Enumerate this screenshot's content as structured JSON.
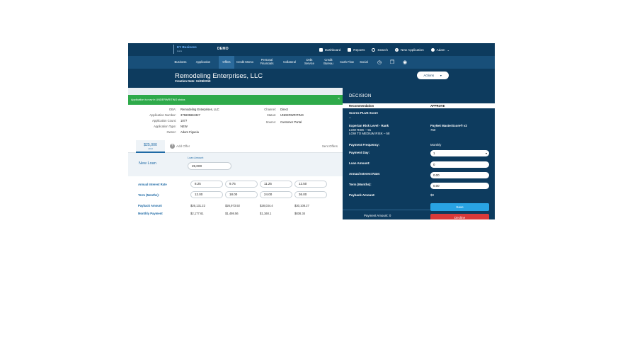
{
  "topbar": {
    "logo_name": "EY Business",
    "logo_sub": "loans",
    "environment": "DEMO",
    "nav": [
      {
        "label": "Dashboard",
        "icon": "dashboard-icon"
      },
      {
        "label": "Reports",
        "icon": "reports-icon"
      },
      {
        "label": "Search",
        "icon": "search-icon"
      },
      {
        "label": "New Application",
        "icon": "plus-circle-icon"
      },
      {
        "label": "Adam",
        "icon": "user-icon"
      }
    ],
    "user_caret": "⌄"
  },
  "tabs": [
    {
      "label": "Business"
    },
    {
      "label": "Application"
    },
    {
      "label": "Offers",
      "active": true
    },
    {
      "label": "Credit Memo"
    },
    {
      "label": "Personal Financials"
    },
    {
      "label": "Collateral"
    },
    {
      "label": "Debt Service"
    },
    {
      "label": "Credit Bureau"
    },
    {
      "label": "Cash Flow"
    },
    {
      "label": "Social"
    }
  ],
  "tab_icons": [
    "history-icon",
    "documents-icon",
    "eye-icon"
  ],
  "header": {
    "company": "Remodeling Enterprises, LLC",
    "created": "Creation Date: 11/26/2019",
    "actions_label": "Actions"
  },
  "banner": {
    "text": "Application is now in UNDERWRITING status",
    "close": "×"
  },
  "details_left": [
    {
      "label": "DBA:",
      "value": "Remodeling Enterprises, LLC"
    },
    {
      "label": "Application Number:",
      "value": "375605684327"
    },
    {
      "label": "Application Count:",
      "value": "1077"
    },
    {
      "label": "Application Type:",
      "value": "NEW"
    },
    {
      "label": "Owner:",
      "value": "Adam Figueia"
    }
  ],
  "details_right": [
    {
      "label": "Channel:",
      "value": "Direct"
    },
    {
      "label": "Status:",
      "value": "UNDERWRITING"
    },
    {
      "label": "Source:",
      "value": "Customer Portal"
    }
  ],
  "offers": {
    "active_amount": "$25,000",
    "active_sub": "ACH",
    "add_label": "Add Offer",
    "sent_label": "Sent Offers"
  },
  "new_loan": {
    "title": "New Loan",
    "amount_label": "Loan Amount",
    "amount_value": "25,000"
  },
  "calc": {
    "interest_label": "Annual Interest Rate",
    "interest_values": [
      "8.25",
      "9.75",
      "11.25",
      "12.50"
    ],
    "term_label": "Term (Months):",
    "term_values": [
      "12.00",
      "18.00",
      "24.00",
      "36.00"
    ],
    "payback_label": "Payback Amount",
    "payback_values": [
      "$26,131.22",
      "$26,973.92",
      "$28,034.4",
      "$30,108.27"
    ],
    "monthly_label": "Monthly Payment",
    "monthly_values": [
      "$2,177.61",
      "$1,498.56",
      "$1,168.1",
      "$836.34"
    ]
  },
  "decision": {
    "title": "DECISION",
    "rec_label": "Recommendation",
    "rec_value": "APPROVE",
    "scorex_label": "Scorex PLUS Score",
    "scorex_value": "--",
    "experian_label": "Experian Risk Level - Rank",
    "experian_line1": "LOW RISK – 91",
    "experian_line2": "LOW TO MEDIUM RISK – 58",
    "paynet_label": "PayNet MasterScore® v2",
    "paynet_value": "750",
    "freq_label": "Payment Frequency:",
    "freq_value": "Monthly",
    "day_label": "Payment Day:",
    "day_value": "1",
    "loan_label": "Loan Amount:",
    "loan_value": "0",
    "rate_label": "Annual Interest Rate:",
    "rate_value": "0.00",
    "term_label": "Term (Months):",
    "term_value": "0.00",
    "payback_label": "Payback Amount:",
    "payback_value": "$0",
    "payment_amount": "Payment Amount:   0",
    "save_label": "Save",
    "decline_label": "Decline"
  }
}
